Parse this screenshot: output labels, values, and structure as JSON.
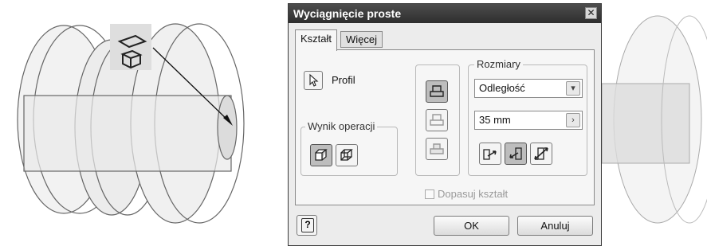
{
  "dialog": {
    "title": "Wyciągnięcie proste",
    "close_glyph": "✕",
    "tabs": [
      {
        "label": "Kształt",
        "active": true
      },
      {
        "label": "Więcej",
        "active": false
      }
    ],
    "profile_label": "Profil",
    "operation_group_label": "Wynik operacji",
    "dimensions_group_label": "Rozmiary",
    "extent_type_value": "Odległość",
    "distance_value": "35 mm",
    "match_shape_label": "Dopasuj kształt",
    "match_shape_checked": false,
    "help_glyph": "?",
    "ok_label": "OK",
    "cancel_label": "Anuluj"
  },
  "icons": {
    "profile": "cursor-arrow-icon",
    "output_solid": "solid-cube-icon",
    "output_surface": "surface-cube-icon",
    "join": "join-icon",
    "cut": "cut-icon",
    "intersect": "intersect-icon",
    "direction_1": "direction-one-icon",
    "direction_2": "direction-two-icon",
    "symmetric": "symmetric-icon",
    "help": "help-icon",
    "extrude_glyph": "extrude-glyph-icon"
  },
  "colors": {
    "titlebar": "#3a3a3a",
    "dialog_bg": "#ececec",
    "pressed_button": "#bdbdbd"
  }
}
